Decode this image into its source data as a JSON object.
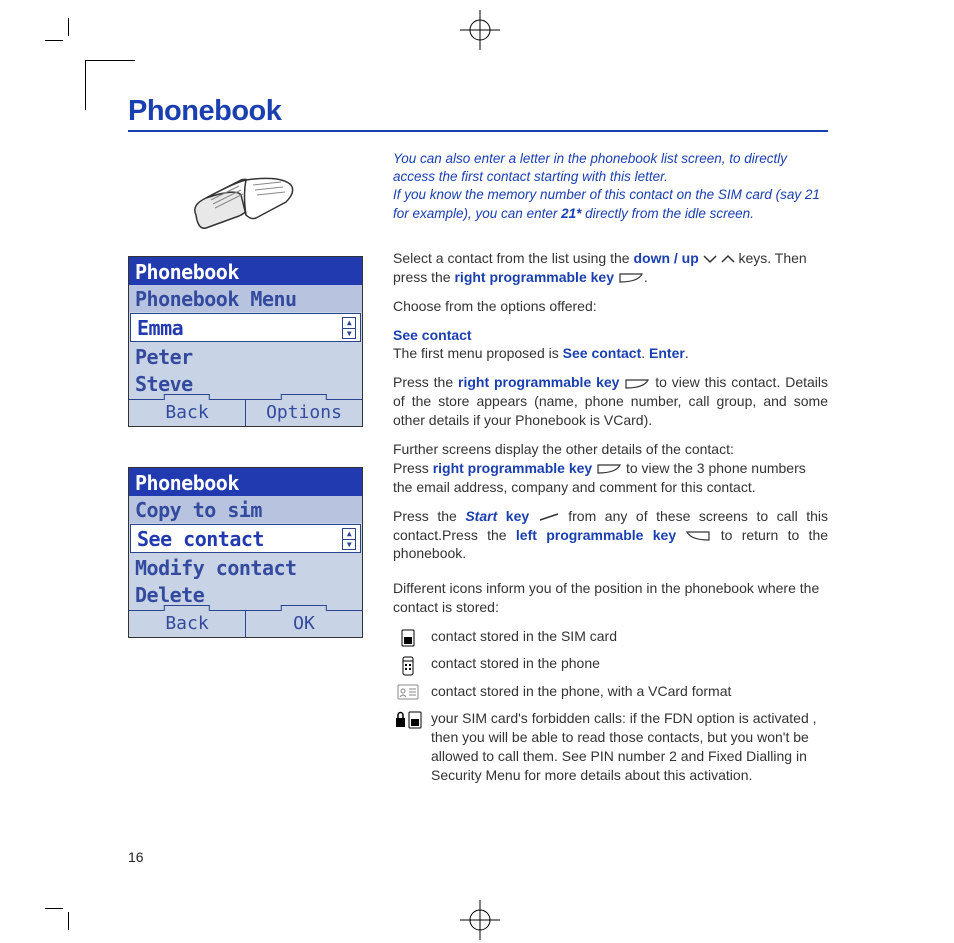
{
  "section_title": "Phonebook",
  "page_number": "16",
  "screen1": {
    "title": "Phonebook",
    "subtitle": "Phonebook Menu",
    "rows": [
      "Emma",
      "Peter",
      "Steve"
    ],
    "selected_index": 0,
    "soft_left": "Back",
    "soft_right": "Options"
  },
  "screen2": {
    "title": "Phonebook",
    "subtitle": "Copy to sim",
    "rows": [
      "See contact",
      "Modify contact",
      "Delete"
    ],
    "selected_index": 0,
    "soft_left": "Back",
    "soft_right": "OK"
  },
  "tip": {
    "line1": "You can also enter a letter in the phonebook list screen, to directly access the first contact starting with this letter.",
    "line2_a": "If you know the memory number of this contact on the SIM card (say 21 for example), you can enter ",
    "line2_bold": "21*",
    "line2_b": " directly from the idle screen."
  },
  "body": {
    "p1_a": "Select a contact from the list using the ",
    "p1_b": "down / up",
    "p1_c": " keys. Then press the ",
    "p1_d": "right programmable key",
    "p1_e": ".",
    "p2": "Choose from the options offered:",
    "see_contact_h": "See contact",
    "p3_a": "The first menu proposed is ",
    "p3_b": "See contact",
    "p3_c": ". ",
    "p3_d": "Enter",
    "p3_e": ".",
    "p4_a": "Press the ",
    "p4_b": "right programmable key",
    "p4_c": " to view this contact. Details of the store appears (name, phone number, call group, and some other details if your Phonebook is VCard).",
    "p5_a": "Further screens display the other details of the contact:",
    "p5_b": "Press ",
    "p5_c": "right programmable key",
    "p5_d": " to view the 3 phone numbers the email address, company and comment for this contact.",
    "p6_a": "Press the ",
    "p6_b": "Start",
    "p6_c": " key",
    "p6_d": " from any of these screens to call this contact.Press the ",
    "p6_e": "left programmable key",
    "p6_f": " to return to the phonebook.",
    "p7": "Different icons inform you of the position in the phonebook where the contact is stored:",
    "icon1": "contact stored in the SIM card",
    "icon2": "contact stored in the phone",
    "icon3": "contact stored in the phone, with a VCard format",
    "icon4": "your SIM card's forbidden calls: if the FDN option is activated , then you will be able to read those contacts, but you won't be allowed to call them.  See PIN number 2 and Fixed Dialling in Security Menu for more details about this activation."
  }
}
